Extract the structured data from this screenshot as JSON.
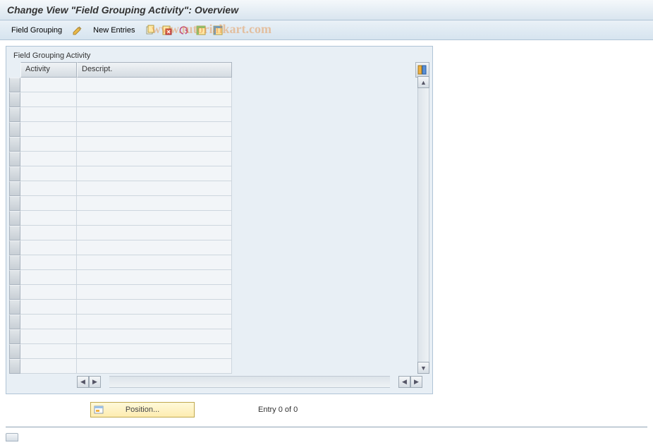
{
  "title": "Change View \"Field Grouping Activity\": Overview",
  "toolbar": {
    "field_grouping_label": "Field Grouping",
    "new_entries_label": "New Entries",
    "icons": {
      "pencil": "change-icon",
      "copy": "copy-icon",
      "delete": "delete-icon",
      "undo": "undo-icon",
      "select_all": "select-all-icon",
      "deselect_all": "deselect-all-icon"
    }
  },
  "watermark": "www.tutorialkart.com",
  "group": {
    "label": "Field Grouping Activity",
    "columns": {
      "activity": "Activity",
      "descript": "Descript."
    },
    "config_icon": "table-settings-icon",
    "rows": [
      {
        "activity": "",
        "descript": ""
      },
      {
        "activity": "",
        "descript": ""
      },
      {
        "activity": "",
        "descript": ""
      },
      {
        "activity": "",
        "descript": ""
      },
      {
        "activity": "",
        "descript": ""
      },
      {
        "activity": "",
        "descript": ""
      },
      {
        "activity": "",
        "descript": ""
      },
      {
        "activity": "",
        "descript": ""
      },
      {
        "activity": "",
        "descript": ""
      },
      {
        "activity": "",
        "descript": ""
      },
      {
        "activity": "",
        "descript": ""
      },
      {
        "activity": "",
        "descript": ""
      },
      {
        "activity": "",
        "descript": ""
      },
      {
        "activity": "",
        "descript": ""
      },
      {
        "activity": "",
        "descript": ""
      },
      {
        "activity": "",
        "descript": ""
      },
      {
        "activity": "",
        "descript": ""
      },
      {
        "activity": "",
        "descript": ""
      },
      {
        "activity": "",
        "descript": ""
      },
      {
        "activity": "",
        "descript": ""
      }
    ]
  },
  "footer": {
    "position_label": "Position...",
    "entry_text": "Entry 0 of 0"
  }
}
